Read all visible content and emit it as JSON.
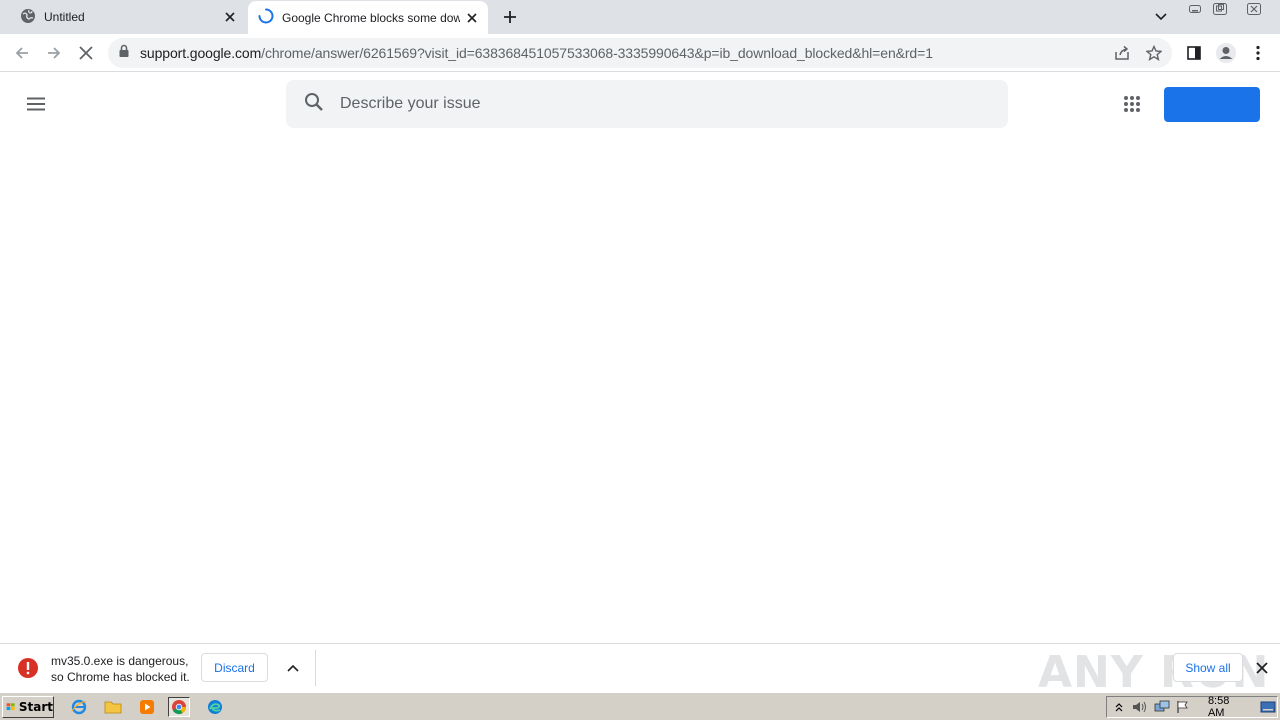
{
  "tabs": [
    {
      "title": "Untitled",
      "active": false
    },
    {
      "title": "Google Chrome blocks some downloads",
      "active": true
    }
  ],
  "omnibox": {
    "host": "support.google.com",
    "path": "/chrome/answer/6261569?visit_id=638368451057533068-3335990643&p=ib_download_blocked&hl=en&rd=1"
  },
  "page": {
    "search_placeholder": "Describe your issue",
    "signin_label": ""
  },
  "download": {
    "message_line1": "mv35.0.exe is dangerous,",
    "message_line2": "so Chrome has blocked it.",
    "discard_label": "Discard",
    "show_all_label": "Show all",
    "watermark": "ANY RUN"
  },
  "taskbar": {
    "start_label": "Start",
    "clock": "8:58 AM"
  },
  "colors": {
    "accent": "#1a73e8",
    "danger": "#d93025",
    "tabstrip": "#dee1e6"
  }
}
